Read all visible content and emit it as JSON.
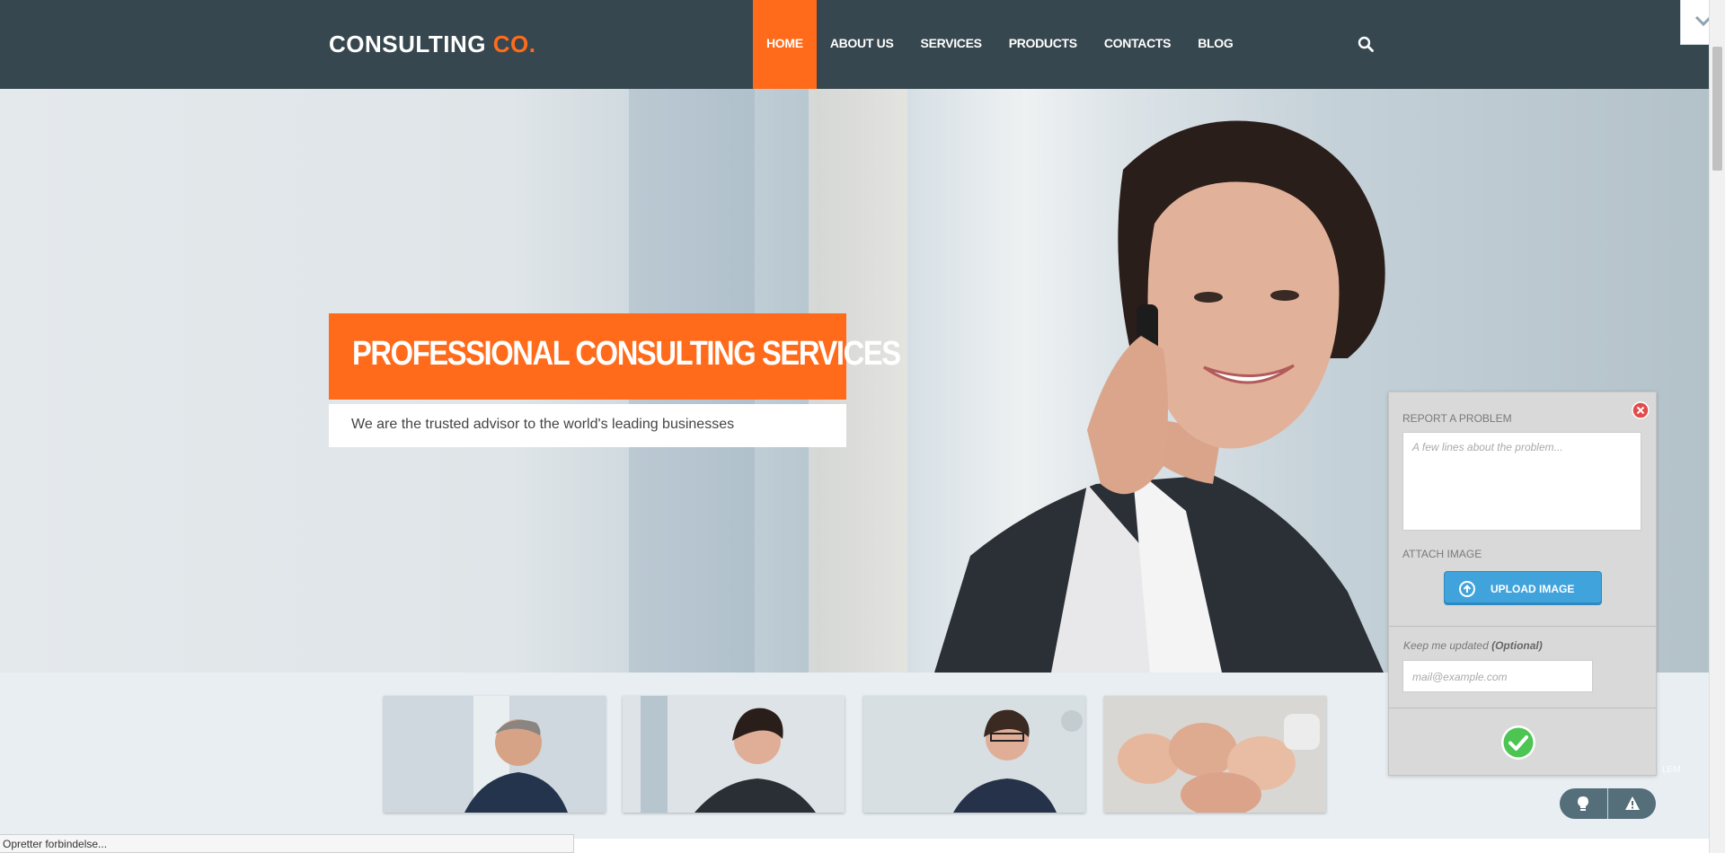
{
  "header": {
    "logo_main": "CONSULTING",
    "logo_accent": "CO."
  },
  "nav": {
    "items": [
      {
        "label": "HOME",
        "active": true
      },
      {
        "label": "ABOUT US",
        "active": false
      },
      {
        "label": "SERVICES",
        "active": false
      },
      {
        "label": "PRODUCTS",
        "active": false
      },
      {
        "label": "CONTACTS",
        "active": false
      },
      {
        "label": "BLOG",
        "active": false
      }
    ],
    "search_icon": "search-icon"
  },
  "hero": {
    "title": "PROFESSIONAL CONSULTING SERVICES",
    "subtitle": "We are the trusted advisor to the world's leading businesses"
  },
  "widget": {
    "report_label": "REPORT A PROBLEM",
    "problem_placeholder": "A few lines about the problem...",
    "attach_label": "ATTACH IMAGE",
    "upload_label": "UPLOAD IMAGE",
    "keep_label": "Keep me updated",
    "keep_optional": "(Optional)",
    "email_placeholder": "mail@example.com",
    "report_hint": "LEM"
  },
  "statusbar": {
    "text": "Opretter forbindelse..."
  },
  "colors": {
    "header_bg": "#37474f",
    "accent": "#ff6b1a",
    "upload_button": "#41a3dc",
    "submit_green": "#4cc552"
  }
}
